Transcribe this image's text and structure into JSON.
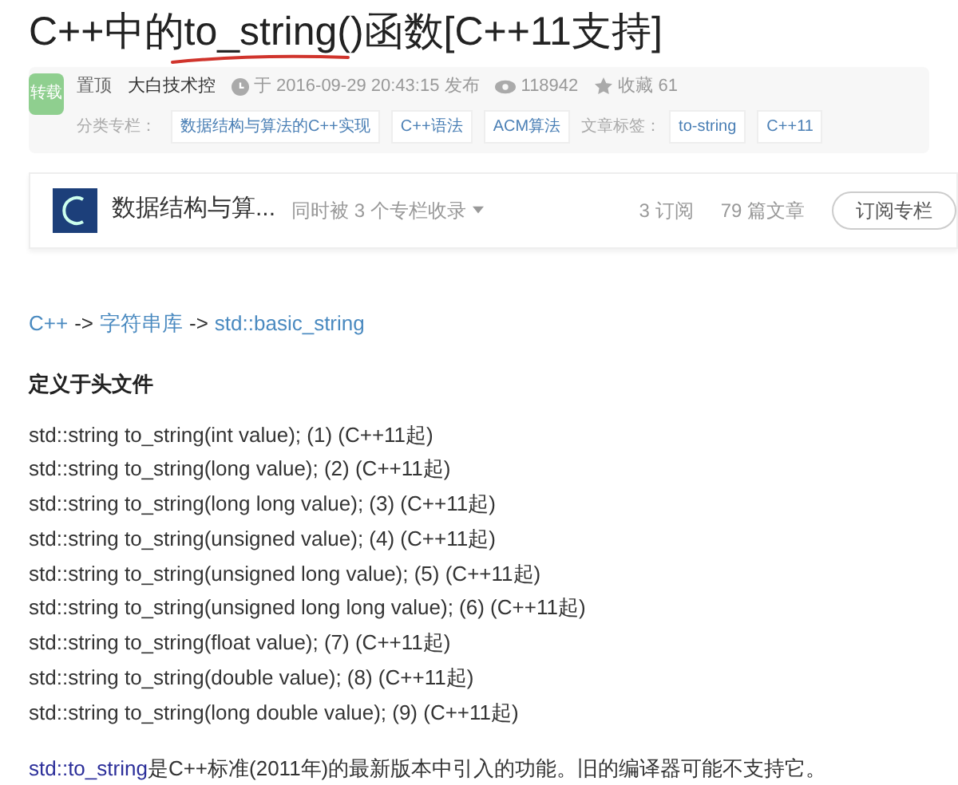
{
  "title": "C++中的to_string()函数[C++11支持]",
  "meta": {
    "badge": "转载",
    "pinned": "置顶",
    "author": "大白技术控",
    "published": "于 2016-09-29 20:43:15 发布",
    "views": "118942",
    "favorites": "收藏 61",
    "category_label": "分类专栏：",
    "categories": [
      "数据结构与算法的C++实现",
      "C++语法",
      "ACM算法"
    ],
    "tags_label": "文章标签：",
    "tags": [
      "to-string",
      "C++11"
    ]
  },
  "column_card": {
    "name": "数据结构与算...",
    "also": "同时被 3 个专栏收录",
    "subscribers": "3 订阅",
    "articles": "79 篇文章",
    "button": "订阅专栏"
  },
  "breadcrumb": [
    {
      "text": "C++",
      "kind": "link"
    },
    {
      "text": "->",
      "kind": "sep"
    },
    {
      "text": "字符串库",
      "kind": "link"
    },
    {
      "text": "->",
      "kind": "sep"
    },
    {
      "text": "std::basic_string",
      "kind": "link"
    }
  ],
  "heading": "定义于头文件",
  "signatures": [
    "std::string to_string(int value); (1) (C++11起)",
    "std::string to_string(long value); (2) (C++11起)",
    "std::string to_string(long long value); (3) (C++11起)",
    "std::string to_string(unsigned value); (4) (C++11起)",
    "std::string to_string(unsigned long value); (5) (C++11起)",
    "std::string to_string(unsigned long long value); (6) (C++11起)",
    "std::string to_string(float value); (7) (C++11起)",
    "std::string to_string(double value); (8) (C++11起)",
    "std::string to_string(long double value); (9) (C++11起)"
  ],
  "note": {
    "link": "std::to_string",
    "text": "是C++标准(2011年)的最新版本中引入的功能。旧的编译器可能不支持它。"
  }
}
